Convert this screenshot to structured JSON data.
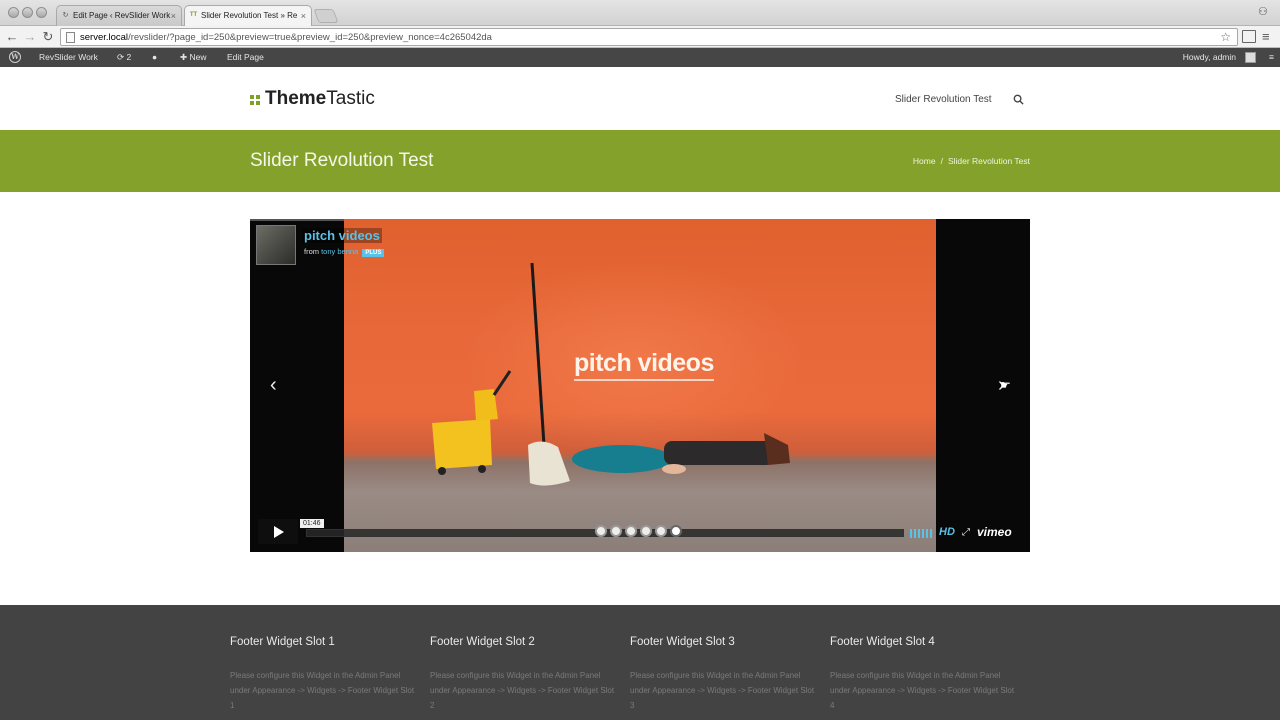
{
  "browser": {
    "tabs": [
      {
        "label": "Edit Page ‹ RevSlider Work",
        "active": false
      },
      {
        "label": "Slider Revolution Test » Re",
        "active": true
      }
    ],
    "tab_favicons": [
      "↻",
      "TT"
    ],
    "url_host": "server.local",
    "url_rest": "/revslider/?page_id=250&preview=true&preview_id=250&preview_nonce=4c265042da"
  },
  "adminbar": {
    "site_name": "RevSlider Work",
    "updates_count": "2",
    "new_label": "New",
    "edit_label": "Edit Page",
    "howdy": "Howdy, admin"
  },
  "header": {
    "logo_bold": "Theme",
    "logo_light": "Tastic",
    "nav_item": "Slider Revolution Test"
  },
  "title_band": {
    "title": "Slider Revolution Test",
    "breadcrumb_home": "Home",
    "breadcrumb_sep": "/",
    "breadcrumb_current": "Slider Revolution Test"
  },
  "video": {
    "head_title": "pitch videos",
    "byline_from": "from",
    "byline_author": "tony benna",
    "byline_badge": "PLUS",
    "overlay_title": "pitch videos",
    "time": "01:46",
    "hd": "HD",
    "vimeo": "vimeo"
  },
  "slider": {
    "dot_count": 6,
    "current_dot": 6
  },
  "footer": {
    "widgets": [
      {
        "title": "Footer Widget Slot 1",
        "text": "Please configure this Widget in the Admin Panel under Appearance -> Widgets -> Footer Widget Slot 1"
      },
      {
        "title": "Footer Widget Slot 2",
        "text": "Please configure this Widget in the Admin Panel under Appearance -> Widgets -> Footer Widget Slot 2"
      },
      {
        "title": "Footer Widget Slot 3",
        "text": "Please configure this Widget in the Admin Panel under Appearance -> Widgets -> Footer Widget Slot 3"
      },
      {
        "title": "Footer Widget Slot 4",
        "text": "Please configure this Widget in the Admin Panel under Appearance -> Widgets -> Footer Widget Slot 4"
      }
    ]
  },
  "colors": {
    "accent_green": "#84a22b",
    "vimeo_blue": "#59c2e8",
    "admin_bar": "#464646",
    "footer_bg": "#434343"
  }
}
